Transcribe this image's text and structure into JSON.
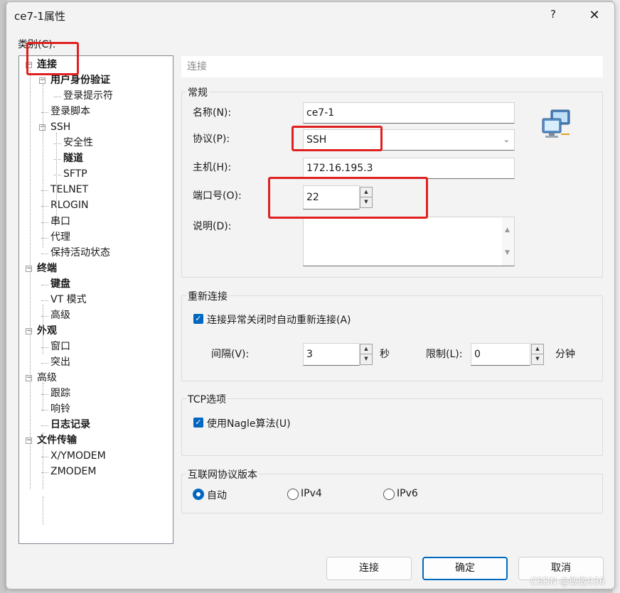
{
  "window": {
    "title": "ce7-1属性",
    "help": "?",
    "close": "✕"
  },
  "category_label": "类别(C):",
  "tree": [
    {
      "label": "连接",
      "bold": true,
      "level": 0,
      "expander": "−"
    },
    {
      "label": "用户身份验证",
      "bold": true,
      "level": 1,
      "expander": "−"
    },
    {
      "label": "登录提示符",
      "bold": false,
      "level": 2
    },
    {
      "label": "登录脚本",
      "bold": false,
      "level": 1
    },
    {
      "label": "SSH",
      "bold": false,
      "level": 1,
      "expander": "−"
    },
    {
      "label": "安全性",
      "bold": false,
      "level": 2
    },
    {
      "label": "隧道",
      "bold": true,
      "level": 2
    },
    {
      "label": "SFTP",
      "bold": false,
      "level": 2
    },
    {
      "label": "TELNET",
      "bold": false,
      "level": 1
    },
    {
      "label": "RLOGIN",
      "bold": false,
      "level": 1
    },
    {
      "label": "串口",
      "bold": false,
      "level": 1
    },
    {
      "label": "代理",
      "bold": false,
      "level": 1
    },
    {
      "label": "保持活动状态",
      "bold": false,
      "level": 1
    },
    {
      "label": "终端",
      "bold": true,
      "level": 0,
      "expander": "−"
    },
    {
      "label": "键盘",
      "bold": true,
      "level": 1
    },
    {
      "label": "VT 模式",
      "bold": false,
      "level": 1
    },
    {
      "label": "高级",
      "bold": false,
      "level": 1
    },
    {
      "label": "外观",
      "bold": true,
      "level": 0,
      "expander": "−"
    },
    {
      "label": "窗口",
      "bold": false,
      "level": 1
    },
    {
      "label": "突出",
      "bold": false,
      "level": 1
    },
    {
      "label": "高级",
      "bold": false,
      "level": 0,
      "expander": "−"
    },
    {
      "label": "跟踪",
      "bold": false,
      "level": 1
    },
    {
      "label": "响铃",
      "bold": false,
      "level": 1
    },
    {
      "label": "日志记录",
      "bold": true,
      "level": 1
    },
    {
      "label": "文件传输",
      "bold": true,
      "level": 0,
      "expander": "−"
    },
    {
      "label": "X/YMODEM",
      "bold": false,
      "level": 1
    },
    {
      "label": "ZMODEM",
      "bold": false,
      "level": 1
    }
  ],
  "panel": {
    "header": "连接",
    "general": {
      "title": "常规",
      "name_label": "名称(N):",
      "name_value": "ce7-1",
      "protocol_label": "协议(P):",
      "protocol_value": "SSH",
      "host_label": "主机(H):",
      "host_value": "172.16.195.3",
      "port_label": "端口号(O):",
      "port_value": "22",
      "desc_label": "说明(D):",
      "desc_value": ""
    },
    "reconnect": {
      "title": "重新连接",
      "checkbox_label": "连接异常关闭时自动重新连接(A)",
      "checked": true,
      "interval_label": "间隔(V):",
      "interval_value": "3",
      "interval_unit": "秒",
      "limit_label": "限制(L):",
      "limit_value": "0",
      "limit_unit": "分钟"
    },
    "tcp": {
      "title": "TCP选项",
      "nagle_label": "使用Nagle算法(U)",
      "checked": true
    },
    "ip": {
      "title": "互联网协议版本",
      "options": [
        "自动",
        "IPv4",
        "IPv6"
      ],
      "selected": "自动"
    }
  },
  "buttons": {
    "connect": "连接",
    "ok": "确定",
    "cancel": "取消"
  },
  "watermark": "CSDN @敢敢936",
  "colors": {
    "accent": "#0067c0",
    "highlight": "#e02020"
  }
}
